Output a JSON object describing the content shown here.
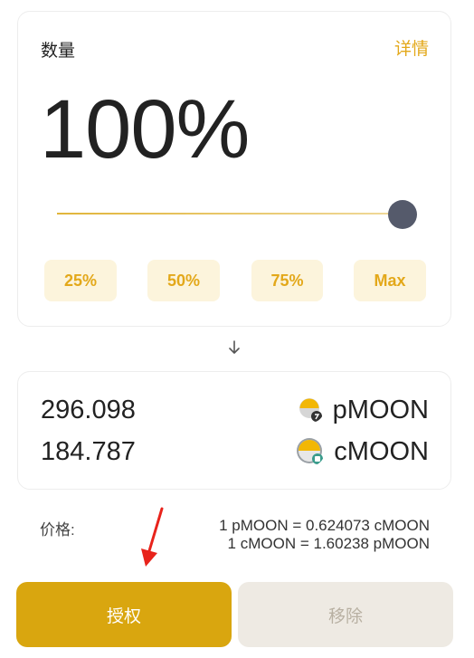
{
  "amount": {
    "label": "数量",
    "detail_link": "详情",
    "percent_text": "100%",
    "slider_value": 1.0,
    "presets": [
      "25%",
      "50%",
      "75%",
      "Max"
    ]
  },
  "result": {
    "rows": [
      {
        "amount": "296.098",
        "token": "pMOON",
        "icon": "pmoon-icon"
      },
      {
        "amount": "184.787",
        "token": "cMOON",
        "icon": "cmoon-icon"
      }
    ]
  },
  "price": {
    "label": "价格:",
    "line1": "1 pMOON = 0.624073 cMOON",
    "line2": "1 cMOON = 1.60238 pMOON"
  },
  "buttons": {
    "approve": "授权",
    "remove": "移除"
  },
  "colors": {
    "accent": "#e3a81a",
    "approve_bg": "#d9a60f",
    "preset_bg": "#fcf4dc",
    "thumb": "#555a6b",
    "annotation": "#e8231b"
  }
}
